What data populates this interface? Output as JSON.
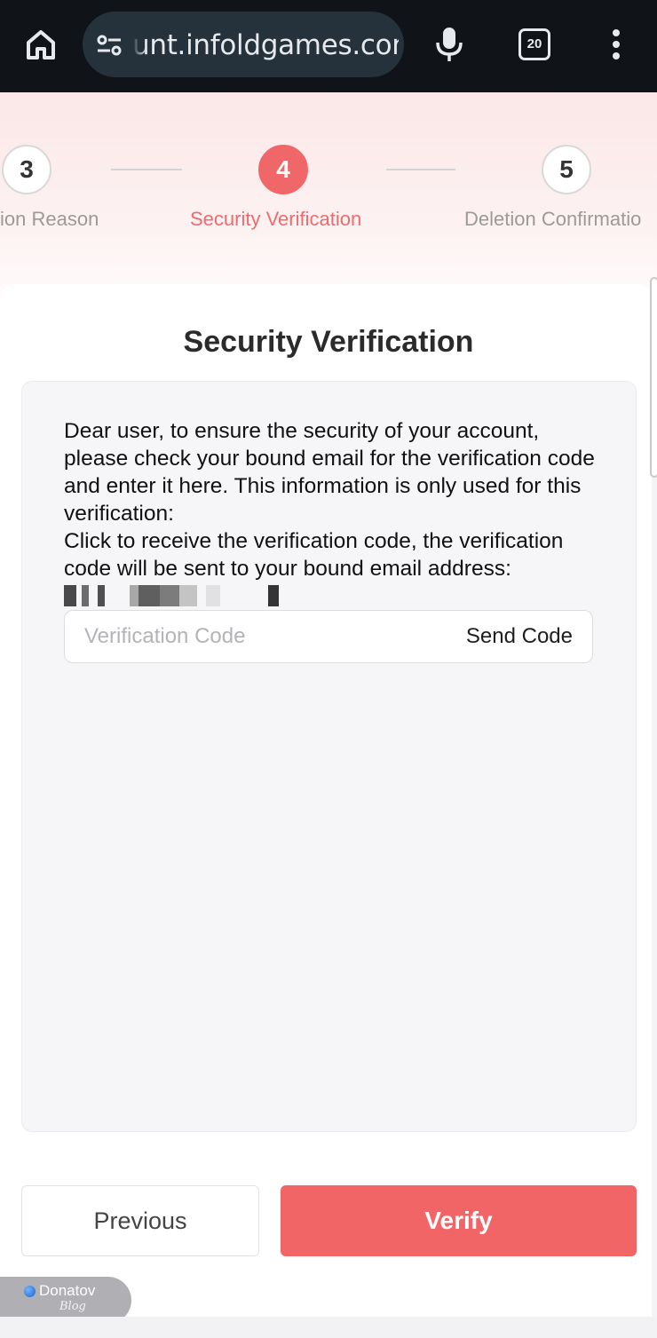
{
  "browser": {
    "url": "unt.infoldgames.com",
    "tab_count": "20",
    "icons": [
      "home-icon",
      "site-settings-icon",
      "mic-icon",
      "tab-switcher-icon",
      "more-vert-icon"
    ]
  },
  "stepper": {
    "steps": [
      {
        "number": "3",
        "label": "ion Reason",
        "state": "done"
      },
      {
        "number": "4",
        "label": "Security Verification",
        "state": "active"
      },
      {
        "number": "5",
        "label": "Deletion Confirmatio",
        "state": "pending"
      }
    ],
    "active_color": "#f0676a"
  },
  "card": {
    "title": "Security Verification",
    "message_line1": "Dear user, to ensure the security of your account, please check your bound email for the verification code and enter it here. This information is only used for this verification:",
    "message_line2": "Click to receive the verification code, the verification code will be sent to your bound email address: ",
    "code_input": {
      "placeholder": "Verification Code",
      "value": ""
    },
    "send_code_label": "Send Code"
  },
  "actions": {
    "previous_label": "Previous",
    "verify_label": "Verify",
    "verify_color": "#f26566"
  },
  "watermark": {
    "name": "Donatov",
    "sub": "Blog"
  }
}
